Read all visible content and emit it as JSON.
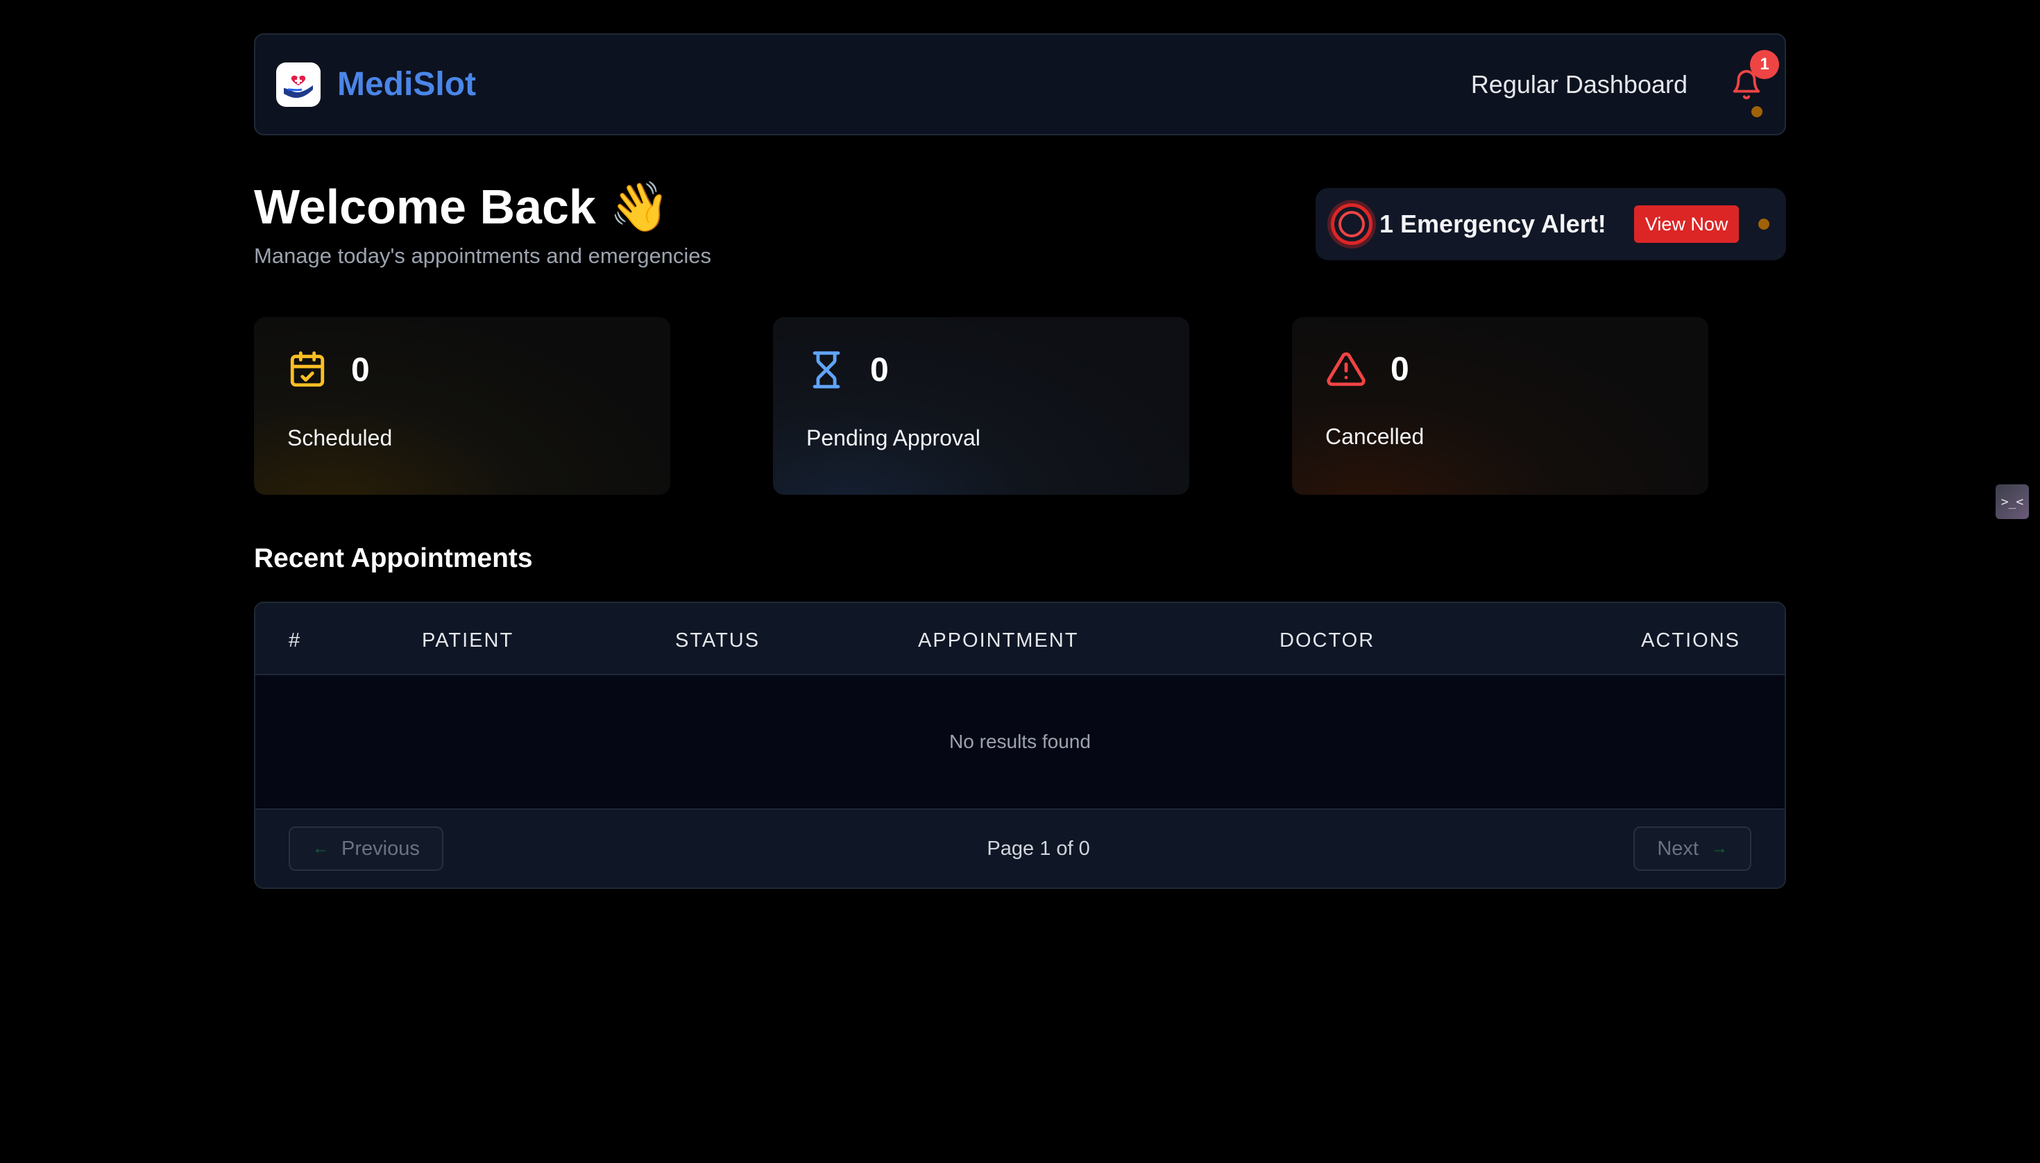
{
  "header": {
    "brand": "MediSlot",
    "dashboard_label": "Regular Dashboard",
    "notification_count": "1"
  },
  "welcome": {
    "title": "Welcome Back 👋",
    "subtitle": "Manage today's appointments and emergencies"
  },
  "alert": {
    "text": "1 Emergency Alert!",
    "button_label": "View Now"
  },
  "stats": [
    {
      "value": "0",
      "label": "Scheduled",
      "icon": "calendar-check-icon",
      "color": "#fbbf24"
    },
    {
      "value": "0",
      "label": "Pending Approval",
      "icon": "hourglass-icon",
      "color": "#60a5fa"
    },
    {
      "value": "0",
      "label": "Cancelled",
      "icon": "warning-triangle-icon",
      "color": "#ef4444"
    }
  ],
  "appointments": {
    "title": "Recent Appointments",
    "columns": [
      "#",
      "PATIENT",
      "STATUS",
      "APPOINTMENT",
      "DOCTOR",
      "ACTIONS"
    ],
    "rows": [],
    "empty_text": "No results found",
    "pagination": {
      "previous_label": "Previous",
      "next_label": "Next",
      "page_info": "Page 1 of 0"
    }
  },
  "side_widget": {
    "label": ">_<"
  },
  "colors": {
    "brand": "#4a86e8",
    "danger": "#dc2626",
    "background": "#000000"
  }
}
